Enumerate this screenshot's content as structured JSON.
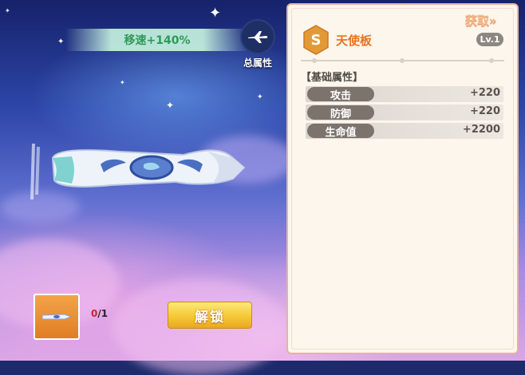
{
  "header": {
    "speed_text": "移速+140%"
  },
  "total_attributes": {
    "label": "总属性",
    "icon": "airplane-icon"
  },
  "item": {
    "count_have": "0",
    "count_sep_total": "/1"
  },
  "unlock_button": {
    "label": "解锁"
  },
  "panel": {
    "get_link": "获取»",
    "rank": "S",
    "name": "天使板",
    "level": "Lv.1",
    "section_title": "【基础属性】",
    "stats": [
      {
        "label": "攻击",
        "value": "+220"
      },
      {
        "label": "防御",
        "value": "+220"
      },
      {
        "label": "生命值",
        "value": "+2200"
      }
    ]
  },
  "colors": {
    "speed_text": "#2f9a55",
    "item_name": "#e8731e",
    "unlock_button": "#f5c936",
    "panel_bg": "#fdf6ec",
    "stat_pill": "#7c736d",
    "rank_badge": "#e39a36"
  }
}
